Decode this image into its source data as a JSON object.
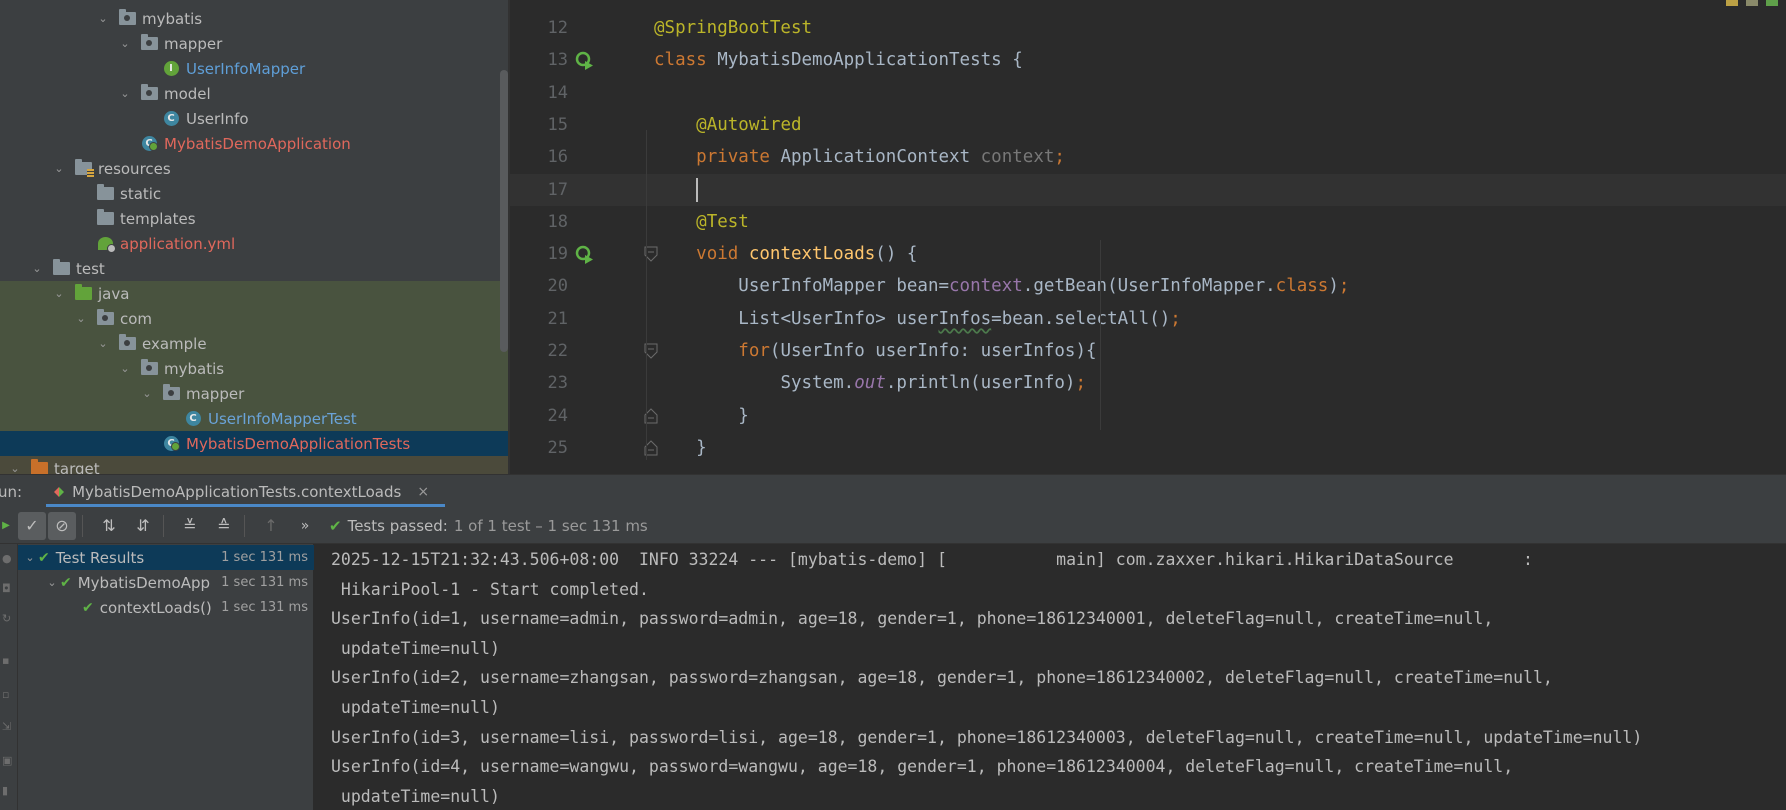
{
  "project_tree": {
    "items": [
      {
        "label": "mybatis",
        "kind": "package",
        "depth": 5,
        "expanded": true,
        "color": "default"
      },
      {
        "label": "mapper",
        "kind": "package",
        "depth": 6,
        "expanded": true,
        "color": "default"
      },
      {
        "label": "UserInfoMapper",
        "kind": "interface",
        "depth": 7,
        "color": "blue"
      },
      {
        "label": "model",
        "kind": "package",
        "depth": 6,
        "expanded": true,
        "color": "default"
      },
      {
        "label": "UserInfo",
        "kind": "class",
        "depth": 7,
        "color": "default"
      },
      {
        "label": "MybatisDemoApplication",
        "kind": "spring-class",
        "depth": 6,
        "color": "red"
      },
      {
        "label": "resources",
        "kind": "resources-folder",
        "depth": 3,
        "expanded": true,
        "color": "default"
      },
      {
        "label": "static",
        "kind": "folder",
        "depth": 4,
        "color": "default"
      },
      {
        "label": "templates",
        "kind": "folder",
        "depth": 4,
        "color": "default"
      },
      {
        "label": "application.yml",
        "kind": "yml",
        "depth": 4,
        "color": "red"
      },
      {
        "label": "test",
        "kind": "folder",
        "depth": 2,
        "expanded": true,
        "color": "default"
      },
      {
        "label": "java",
        "kind": "green-folder",
        "depth": 3,
        "expanded": true,
        "color": "default",
        "highlight": "green"
      },
      {
        "label": "com",
        "kind": "package",
        "depth": 4,
        "expanded": true,
        "color": "default",
        "highlight": "green"
      },
      {
        "label": "example",
        "kind": "package",
        "depth": 5,
        "expanded": true,
        "color": "default",
        "highlight": "green"
      },
      {
        "label": "mybatis",
        "kind": "package",
        "depth": 6,
        "expanded": true,
        "color": "default",
        "highlight": "green"
      },
      {
        "label": "mapper",
        "kind": "package",
        "depth": 7,
        "expanded": true,
        "color": "default",
        "highlight": "green"
      },
      {
        "label": "UserInfoMapperTest",
        "kind": "class",
        "depth": 8,
        "color": "test-blue",
        "highlight": "green"
      },
      {
        "label": "MybatisDemoApplicationTests",
        "kind": "spring-class",
        "depth": 7,
        "color": "red",
        "highlight": "selected"
      },
      {
        "label": "target",
        "kind": "orange-folder",
        "depth": 1,
        "expanded": true,
        "color": "default",
        "highlight": "target"
      }
    ]
  },
  "editor": {
    "lines": [
      {
        "no": "12",
        "tokens": [
          {
            "t": "@SpringBootTest",
            "c": "ann"
          }
        ]
      },
      {
        "no": "13",
        "run_icon": true,
        "tokens": [
          {
            "t": "class ",
            "c": "kw"
          },
          {
            "t": "MybatisDemoApplicationTests {",
            "c": "code"
          }
        ]
      },
      {
        "no": "14",
        "tokens": []
      },
      {
        "no": "15",
        "tokens": [
          {
            "t": "    "
          },
          {
            "t": "@Autowired",
            "c": "ann"
          }
        ]
      },
      {
        "no": "16",
        "tokens": [
          {
            "t": "    "
          },
          {
            "t": "private ",
            "c": "kw"
          },
          {
            "t": "ApplicationContext ",
            "c": "code"
          },
          {
            "t": "context",
            "c": "dim"
          },
          {
            "t": ";",
            "c": "kw"
          }
        ]
      },
      {
        "no": "17",
        "current": true,
        "caret": true,
        "tokens": [
          {
            "t": "    "
          }
        ]
      },
      {
        "no": "18",
        "tokens": [
          {
            "t": "    "
          },
          {
            "t": "@Test",
            "c": "ann"
          }
        ]
      },
      {
        "no": "19",
        "run_icon": true,
        "fold": "open",
        "tokens": [
          {
            "t": "    "
          },
          {
            "t": "void ",
            "c": "kw"
          },
          {
            "t": "contextLoads",
            "c": "fn"
          },
          {
            "t": "() {",
            "c": "code"
          }
        ]
      },
      {
        "no": "20",
        "tokens": [
          {
            "t": "        "
          },
          {
            "t": "UserInfoMapper bean=",
            "c": "code"
          },
          {
            "t": "context",
            "c": "fld"
          },
          {
            "t": ".getBean(UserInfoMapper.",
            "c": "code"
          },
          {
            "t": "class",
            "c": "kw"
          },
          {
            "t": ")",
            "c": "code"
          },
          {
            "t": ";",
            "c": "kw"
          }
        ]
      },
      {
        "no": "21",
        "tokens": [
          {
            "t": "        "
          },
          {
            "t": "List<UserInfo> user",
            "c": "code"
          },
          {
            "t": "Infos",
            "c": "typo"
          },
          {
            "t": "=bean.selectAll()",
            "c": "code"
          },
          {
            "t": ";",
            "c": "kw"
          }
        ]
      },
      {
        "no": "22",
        "fold": "open",
        "tokens": [
          {
            "t": "        "
          },
          {
            "t": "for",
            "c": "kw"
          },
          {
            "t": "(UserInfo userInfo: userInfos){",
            "c": "code"
          }
        ]
      },
      {
        "no": "23",
        "tokens": [
          {
            "t": "            "
          },
          {
            "t": "System.",
            "c": "code"
          },
          {
            "t": "out",
            "c": "fld-i"
          },
          {
            "t": ".println(userInfo)",
            "c": "code"
          },
          {
            "t": ";",
            "c": "kw"
          }
        ]
      },
      {
        "no": "24",
        "fold": "close",
        "tokens": [
          {
            "t": "        "
          },
          {
            "t": "}",
            "c": "code"
          }
        ]
      },
      {
        "no": "25",
        "fold": "close",
        "tokens": [
          {
            "t": "    "
          },
          {
            "t": "}",
            "c": "code"
          }
        ]
      }
    ]
  },
  "run": {
    "label": "un:",
    "tab_title": "MybatisDemoApplicationTests.contextLoads",
    "close_icon": "×",
    "status_label": "Tests passed: ",
    "status_detail": "1 of 1 test – 1 sec 131 ms",
    "test_tree": [
      {
        "name": "Test Results",
        "time": "1 sec 131 ms",
        "depth": 0,
        "selected": true
      },
      {
        "name": "MybatisDemoApp",
        "time": "1 sec 131 ms",
        "depth": 1
      },
      {
        "name": "contextLoads()",
        "time": "1 sec 131 ms",
        "depth": 2
      }
    ],
    "console": [
      "2025-12-15T21:32:43.506+08:00  INFO 33224 --- [mybatis-demo] [           main] com.zaxxer.hikari.HikariDataSource       :",
      " HikariPool-1 - Start completed.",
      "UserInfo(id=1, username=admin, password=admin, age=18, gender=1, phone=18612340001, deleteFlag=null, createTime=null,",
      " updateTime=null)",
      "UserInfo(id=2, username=zhangsan, password=zhangsan, age=18, gender=1, phone=18612340002, deleteFlag=null, createTime=null,",
      " updateTime=null)",
      "UserInfo(id=3, username=lisi, password=lisi, age=18, gender=1, phone=18612340003, deleteFlag=null, createTime=null, updateTime=null)",
      "UserInfo(id=4, username=wangwu, password=wangwu, age=18, gender=1, phone=18612340004, deleteFlag=null, createTime=null,",
      " updateTime=null)"
    ]
  },
  "colors": {
    "accent": "#4a88c7",
    "pass_green": "#5fb346",
    "keyword": "#cc7832",
    "annotation": "#bbb529"
  }
}
